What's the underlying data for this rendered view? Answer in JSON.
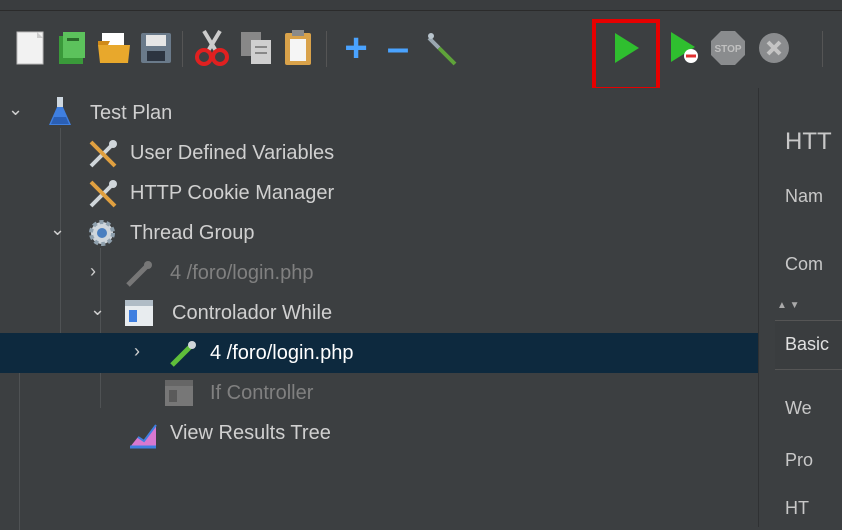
{
  "toolbar": {
    "buttons": [
      {
        "name": "new-icon"
      },
      {
        "name": "templates-icon"
      },
      {
        "name": "open-icon"
      },
      {
        "name": "save-icon"
      },
      {
        "name": "cut-icon"
      },
      {
        "name": "copy-icon"
      },
      {
        "name": "paste-icon"
      },
      {
        "name": "expand-all-icon",
        "glyph": "+"
      },
      {
        "name": "collapse-all-icon",
        "glyph": "–"
      },
      {
        "name": "toggle-icon"
      },
      {
        "name": "start-icon"
      },
      {
        "name": "start-no-pauses-icon"
      },
      {
        "name": "stop-icon",
        "label": "STOP"
      },
      {
        "name": "shutdown-icon"
      }
    ],
    "highlight_color": "#e60000"
  },
  "tree": {
    "items": [
      {
        "label": "Test Plan",
        "icon": "flask-icon",
        "expanded": true
      },
      {
        "label": "User Defined Variables",
        "icon": "wrench-icon"
      },
      {
        "label": "HTTP Cookie Manager",
        "icon": "wrench-icon"
      },
      {
        "label": "Thread Group",
        "icon": "gear-icon",
        "expanded": true
      },
      {
        "label": "4 /foro/login.php",
        "icon": "pipette-icon",
        "disabled": true
      },
      {
        "label": "Controlador While",
        "icon": "controller-icon",
        "expanded": true
      },
      {
        "label": "4 /foro/login.php",
        "icon": "pipette-icon",
        "selected": true
      },
      {
        "label": "If Controller",
        "icon": "controller-icon",
        "disabled": true
      },
      {
        "label": "View Results Tree",
        "icon": "chart-icon"
      }
    ]
  },
  "right_panel": {
    "title": "HTT",
    "name_label": "Nam",
    "comments_label": "Com",
    "tab": "Basic",
    "web_label": "We",
    "protocol_label": "Pro",
    "http_label": "HT"
  }
}
